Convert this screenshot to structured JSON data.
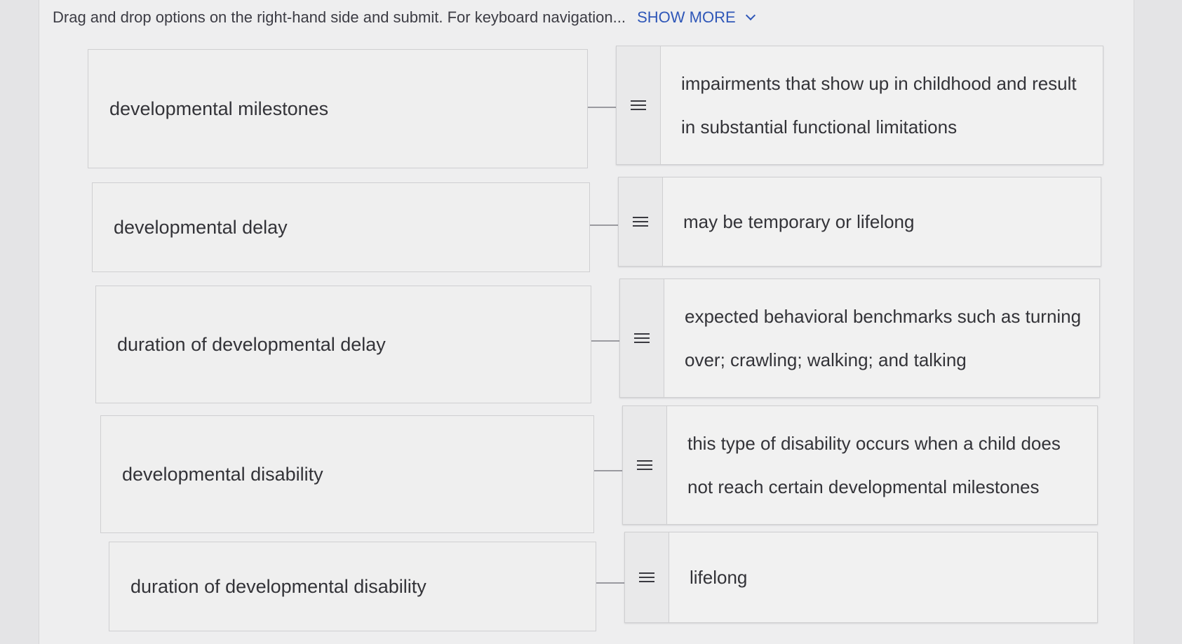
{
  "header": {
    "instructions": "Drag and drop options on the right-hand side and submit. For keyboard navigation...",
    "show_more_label": "SHOW MORE"
  },
  "terms": [
    "developmental milestones",
    "developmental delay",
    "duration of developmental delay",
    "developmental disability",
    "duration of developmental disability"
  ],
  "answers": [
    "impairments that show up in childhood and result in substantial functional limitations",
    "may be temporary or lifelong",
    "expected behavioral benchmarks such as turning over; crawling; walking; and talking",
    "this type of disability occurs when a child does not reach certain developmental milestones",
    "lifelong"
  ],
  "icons": {
    "drag_handle": "drag-handle-icon",
    "chevron": "chevron-down-icon"
  },
  "colors": {
    "link": "#2f57b8"
  }
}
